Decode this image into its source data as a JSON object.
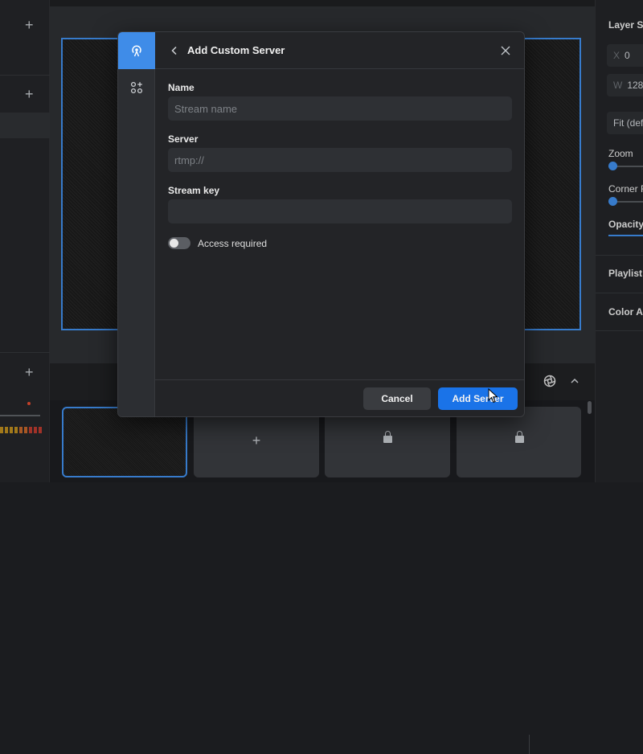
{
  "modal": {
    "title": "Add Custom Server",
    "fields": {
      "name": {
        "label": "Name",
        "placeholder": "Stream name",
        "value": ""
      },
      "server": {
        "label": "Server",
        "placeholder": "rtmp://",
        "value": ""
      },
      "stream_key": {
        "label": "Stream key",
        "placeholder": "",
        "value": ""
      }
    },
    "toggle": {
      "label": "Access required",
      "on": false
    },
    "buttons": {
      "cancel": "Cancel",
      "submit": "Add Server"
    },
    "side_tabs": [
      "broadcast-icon",
      "apps-add-icon"
    ]
  },
  "right_panel": {
    "section_title": "Layer Se",
    "x_label": "X",
    "x_value": "0",
    "w_label": "W",
    "w_value": "128",
    "fit_value": "Fit (def",
    "zoom_label": "Zoom",
    "corner_label": "Corner R",
    "opacity_label": "Opacity",
    "playlist_label": "Playlist",
    "color_label": "Color Ac"
  },
  "colors": {
    "accent": "#3f8ce8",
    "primary_button": "#1a73e8",
    "background": "#1b1c1f"
  }
}
